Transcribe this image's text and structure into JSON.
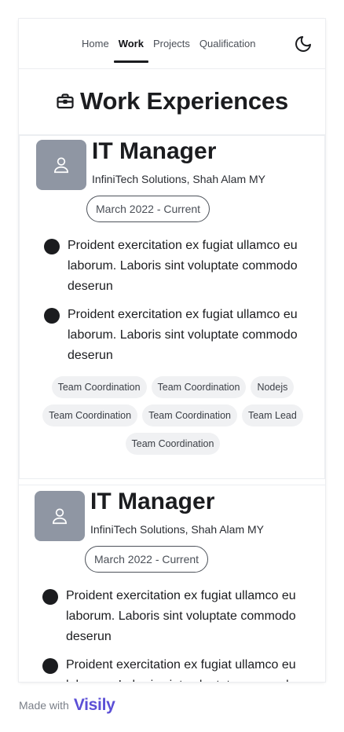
{
  "nav": {
    "items": [
      {
        "label": "Home",
        "active": false
      },
      {
        "label": "Work",
        "active": true
      },
      {
        "label": "Projects",
        "active": false
      },
      {
        "label": "Qualification",
        "active": false
      }
    ],
    "theme_icon": "moon-icon"
  },
  "page": {
    "title": "Work Experiences",
    "title_icon": "briefcase-icon"
  },
  "experiences": [
    {
      "title": "IT Manager",
      "company": "InfiniTech Solutions, Shah Alam MY",
      "period": "March 2022 - Current",
      "avatar_icon": "user-icon",
      "bullets": [
        "Proident exercitation ex fugiat ullamco eu laborum. Laboris sint voluptate commodo deserun",
        "Proident exercitation ex fugiat ullamco eu laborum. Laboris sint voluptate commodo deserun"
      ],
      "tags": [
        "Team Coordination",
        "Team Coordination",
        "Nodejs",
        "Team Coordination",
        "Team Coordination",
        "Team Lead",
        "Team Coordination"
      ]
    },
    {
      "title": "IT Manager",
      "company": "InfiniTech Solutions, Shah Alam MY",
      "period": "March 2022 - Current",
      "avatar_icon": "user-icon",
      "bullets": [
        "Proident exercitation ex fugiat ullamco eu laborum. Laboris sint voluptate commodo deserun",
        "Proident exercitation ex fugiat ullamco eu laborum. Laboris sint voluptate commodo deserun"
      ],
      "tags": []
    }
  ],
  "footer": {
    "made_with": "Made with",
    "brand": "Visily"
  },
  "colors": {
    "text": "#1b1c1f",
    "avatar_bg": "#8f96a3",
    "tag_bg": "#f0f1f3",
    "brand": "#5b4fd6"
  }
}
